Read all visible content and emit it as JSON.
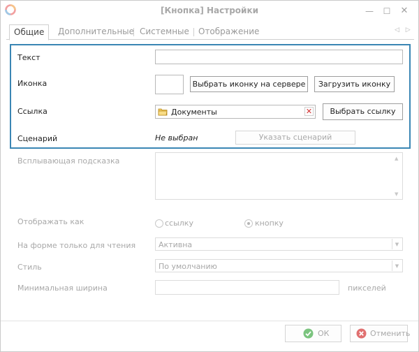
{
  "window": {
    "title": "[Кнопка] Настройки",
    "minimize_glyph": "—",
    "maximize_glyph": "☐",
    "close_glyph": "✕"
  },
  "tabs": [
    {
      "label": "Общие",
      "active": true
    },
    {
      "label": "Дополнительные",
      "active": false
    },
    {
      "label": "Системные",
      "active": false
    },
    {
      "label": "Отображение",
      "active": false
    }
  ],
  "tab_scroll": "◁ ▷",
  "form": {
    "text": {
      "label": "Текст",
      "value": ""
    },
    "icon": {
      "label": "Иконка",
      "choose_server_label": "Выбрать иконку на сервере",
      "upload_label": "Загрузить иконку"
    },
    "link": {
      "label": "Ссылка",
      "value": "Документы",
      "clear_glyph": "✕",
      "choose_link_label": "Выбрать ссылку"
    },
    "scenario": {
      "label": "Сценарий",
      "value": "Не выбран",
      "specify_label": "Указать сценарий"
    },
    "tooltip": {
      "label": "Всплывающая подсказка",
      "value": ""
    },
    "display_as": {
      "label": "Отображать как",
      "options": [
        "ссылку",
        "кнопку"
      ],
      "selected": "кнопку"
    },
    "readonly_form": {
      "label": "На форме только для чтения",
      "value": "Активна"
    },
    "style": {
      "label": "Стиль",
      "value": "По умолчанию"
    },
    "min_width": {
      "label": "Минимальная ширина",
      "value": "",
      "unit": "пикселей"
    }
  },
  "footer": {
    "ok_label": "ОК",
    "cancel_label": "Отменить"
  },
  "colors": {
    "highlight_border": "#3a86b4",
    "ok_icon": "#7bc47f",
    "cancel_icon": "#e07070",
    "clear_x": "#d23030"
  }
}
